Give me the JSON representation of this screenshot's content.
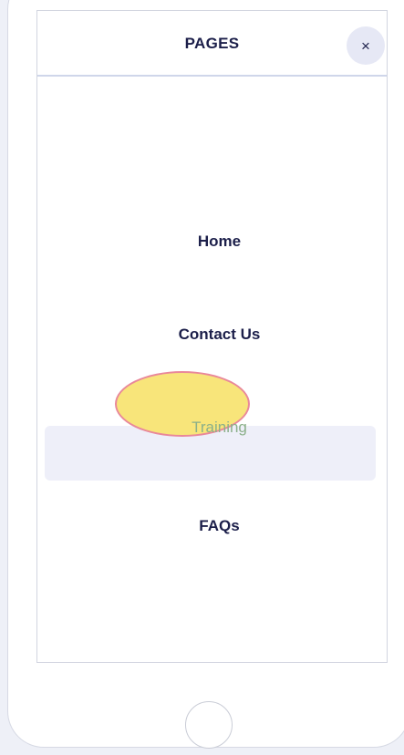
{
  "menu": {
    "title": "PAGES",
    "close_icon_glyph": "×",
    "items": [
      {
        "label": "Home",
        "active": false
      },
      {
        "label": "Contact Us",
        "active": false
      },
      {
        "label": "Training",
        "active": true
      },
      {
        "label": "FAQs",
        "active": false
      }
    ]
  },
  "colors": {
    "text": "#1c1f4a",
    "active_bg": "#eeeff9",
    "active_text": "#8bb08a",
    "highlight_fill": "#f8e57a",
    "highlight_border": "#e9889a"
  },
  "icons": {
    "close": "close-icon",
    "home": "home-button"
  }
}
